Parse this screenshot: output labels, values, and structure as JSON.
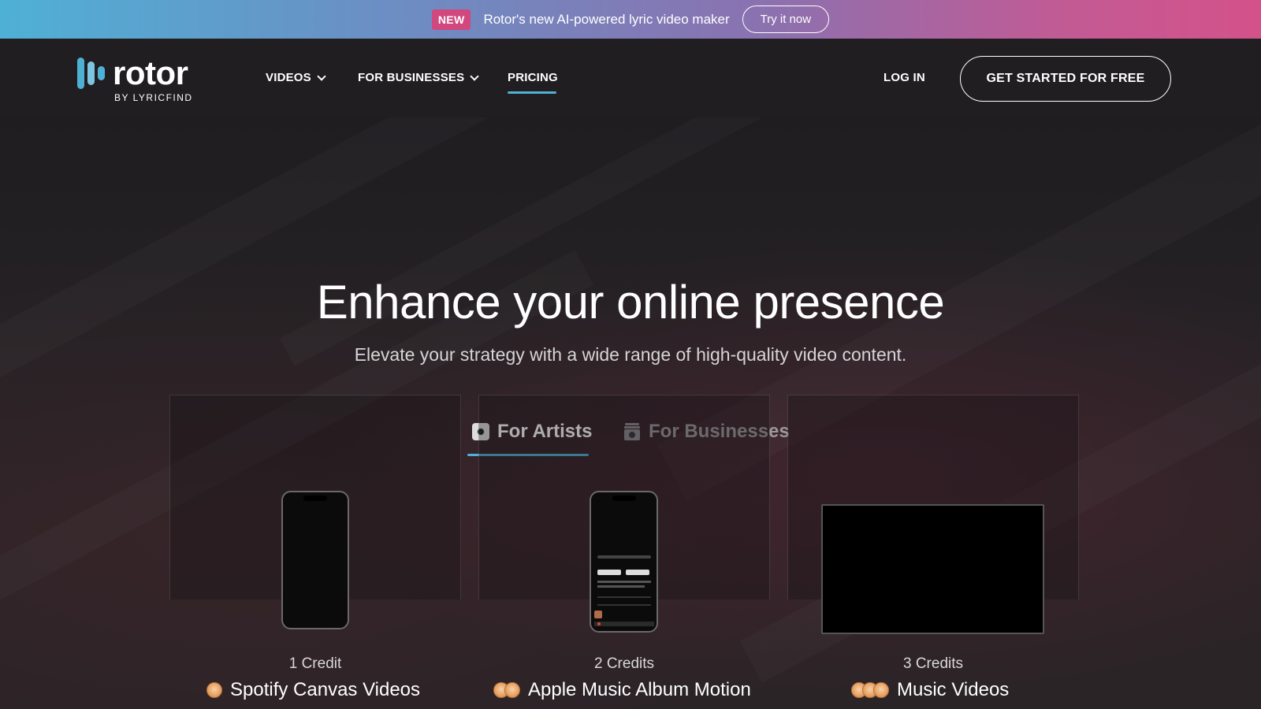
{
  "announcement": {
    "badge": "NEW",
    "text": "Rotor's new AI-powered lyric video maker",
    "cta": "Try it now"
  },
  "nav": {
    "logo_name": "rotor",
    "logo_sub": "BY LYRICFIND",
    "items": [
      {
        "label": "VIDEOS",
        "has_dropdown": true
      },
      {
        "label": "FOR BUSINESSES",
        "has_dropdown": true
      },
      {
        "label": "PRICING",
        "active": true
      }
    ],
    "login": "LOG IN",
    "cta": "GET STARTED FOR FREE"
  },
  "hero": {
    "title": "Enhance your online presence",
    "subtitle": "Elevate your strategy with a wide range of high-quality video content."
  },
  "tabs": [
    {
      "label": "For Artists",
      "icon": "vinyl-icon",
      "active": true
    },
    {
      "label": "For Businesses",
      "icon": "store-icon",
      "active": false
    }
  ],
  "cards": [
    {
      "credits": "1 Credit",
      "title": "Spotify Canvas Videos",
      "coin_count": 1,
      "preview": "phone-blank"
    },
    {
      "credits": "2 Credits",
      "title": "Apple Music Album Motion",
      "coin_count": 2,
      "preview": "phone-music-app"
    },
    {
      "credits": "3 Credits",
      "title": "Music Videos",
      "coin_count": 3,
      "preview": "widescreen"
    }
  ],
  "colors": {
    "accent": "#4fb0d6",
    "badge": "#d1487f",
    "background": "#1f1d20",
    "coin": "#e9a468"
  }
}
